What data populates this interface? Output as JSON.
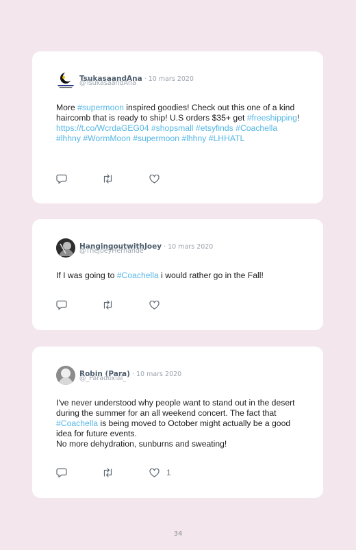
{
  "posts": [
    {
      "name": "TsukasaandAna",
      "sep": " · ",
      "date": "10 mars 2020",
      "handle": "@TsukasaandAna",
      "text": [
        {
          "t": "More ",
          "tag": false
        },
        {
          "t": "#supermoon",
          "tag": true
        },
        {
          "t": " inspired goodies! Check out this one of a kind haircomb that is ready to ship! U.S orders $35+ get ",
          "tag": false
        },
        {
          "t": "#freeshipping",
          "tag": true
        },
        {
          "t": "! ",
          "tag": false
        },
        {
          "t": "https://t.co/WcrdaGEG04",
          "tag": true
        },
        {
          "t": " ",
          "tag": false
        },
        {
          "t": "#shopsmall",
          "tag": true
        },
        {
          "t": " ",
          "tag": false
        },
        {
          "t": "#etsyfinds",
          "tag": true
        },
        {
          "t": " ",
          "tag": false
        },
        {
          "t": "#Coachella",
          "tag": true
        },
        {
          "t": " ",
          "tag": false
        },
        {
          "t": "#lhhny",
          "tag": true
        },
        {
          "t": " ",
          "tag": false
        },
        {
          "t": "#WormMoon",
          "tag": true
        },
        {
          "t": " ",
          "tag": false
        },
        {
          "t": "#supermoon",
          "tag": true
        },
        {
          "t": " ",
          "tag": false
        },
        {
          "t": "#lhhny",
          "tag": true
        },
        {
          "t": " ",
          "tag": false
        },
        {
          "t": "#LHHATL",
          "tag": true
        }
      ],
      "likes": ""
    },
    {
      "name": "HangingoutwithJoey",
      "sep": " · ",
      "date": "10 mars 2020",
      "handle": "@TheJoeyHernande",
      "text": [
        {
          "t": "If I was going to ",
          "tag": false
        },
        {
          "t": "#Coachella",
          "tag": true
        },
        {
          "t": " i would rather go in the Fall!",
          "tag": false
        }
      ],
      "likes": ""
    },
    {
      "name": "Robin (Para)",
      "sep": " · ",
      "date": "10 mars 2020",
      "handle": "@_Paradoxial_",
      "text": [
        {
          "t": "I've never understood why people want to stand out in the desert during the summer for an all weekend concert. The fact that ",
          "tag": false
        },
        {
          "t": "#Coachella",
          "tag": true
        },
        {
          "t": " is being moved to October might actually be a good idea for future events.\nNo more dehydration, sunburns and sweating!",
          "tag": false
        }
      ],
      "likes": "1"
    }
  ],
  "page_number": "34",
  "colors": {
    "background": "#f3e6ec",
    "card": "#ffffff",
    "hashtag": "#55b7e6",
    "icon": "#5c6670"
  },
  "icons": [
    "reply-icon",
    "retweet-icon",
    "like-icon"
  ]
}
